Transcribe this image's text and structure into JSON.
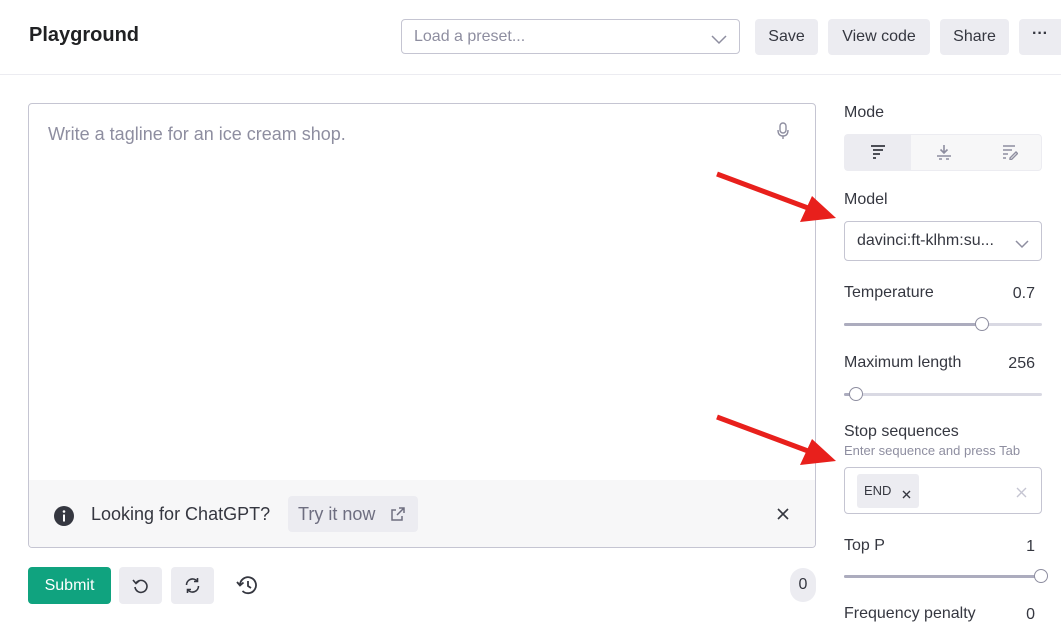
{
  "header": {
    "title": "Playground",
    "preset_placeholder": "Load a preset...",
    "buttons": {
      "save": "Save",
      "view_code": "View code",
      "share": "Share",
      "more": "···"
    }
  },
  "editor": {
    "prompt_text": "Write a tagline for an ice cream shop.",
    "banner": {
      "text": "Looking for ChatGPT?",
      "try_label": "Try it now"
    }
  },
  "footer": {
    "submit_label": "Submit",
    "token_count": "0"
  },
  "sidebar": {
    "mode_label": "Mode",
    "mode_options": [
      "complete-icon",
      "insert-icon",
      "edit-icon"
    ],
    "model_label": "Model",
    "model_value": "davinci:ft-klhm:su...",
    "temperature": {
      "label": "Temperature",
      "value": "0.7",
      "level": 0.7
    },
    "max_length": {
      "label": "Maximum length",
      "value": "256",
      "level": 0.064
    },
    "stop_sequences": {
      "label": "Stop sequences",
      "hint": "Enter sequence and press Tab",
      "chips": [
        "END"
      ]
    },
    "top_p": {
      "label": "Top P",
      "value": "1",
      "level": 1.0
    },
    "frequency_penalty": {
      "label": "Frequency penalty",
      "value": "0"
    }
  },
  "colors": {
    "accent": "#10a37f",
    "annotation_arrow": "#e8201c"
  }
}
